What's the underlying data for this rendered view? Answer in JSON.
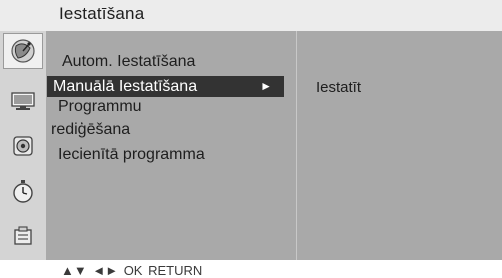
{
  "header": {
    "title": "Iestatīšana"
  },
  "sidebar": {
    "icons": [
      {
        "name": "setup-icon",
        "selected": true
      },
      {
        "name": "picture-icon",
        "selected": false
      },
      {
        "name": "audio-icon",
        "selected": false
      },
      {
        "name": "time-icon",
        "selected": false
      },
      {
        "name": "option-icon",
        "selected": false
      }
    ]
  },
  "menu": {
    "items": [
      {
        "label": "Autom. Iestatīšana",
        "selected": false
      },
      {
        "label": "Manuālā Iestatīšana",
        "selected": true,
        "arrow": "►"
      },
      {
        "label": "Programmu",
        "selected": false
      },
      {
        "label": "rediģēšana",
        "selected": false
      },
      {
        "label": "Iecienītā programma",
        "selected": false
      }
    ]
  },
  "submenu": {
    "items": [
      {
        "label": "Iestatīt"
      }
    ]
  },
  "help": {
    "text": "▲▼ ◄► OK RETURN"
  },
  "colors": {
    "panel": "#a9a9a9",
    "icon_column": "#d4d4d4",
    "title_bar": "#ececec",
    "highlight": "#333333"
  }
}
